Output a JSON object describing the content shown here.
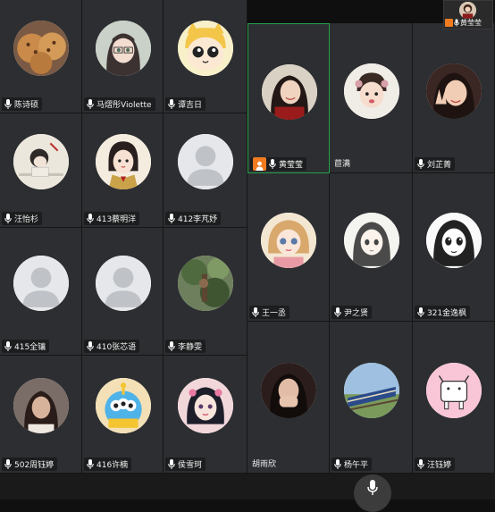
{
  "left_grid": {
    "rows": [
      [
        {
          "name": "陈诗硕",
          "avatar": "cookies",
          "mic": true
        },
        {
          "name": "马熠彤Violette",
          "avatar": "anime-girl",
          "mic": true
        },
        {
          "name": "谭吉日",
          "avatar": "popteam",
          "mic": true
        }
      ],
      [
        {
          "name": "汪怡杉",
          "avatar": "sketch-child",
          "mic": true
        },
        {
          "name": "413蔡明洋",
          "avatar": "cartoon-officer",
          "mic": true
        },
        {
          "name": "412李芃妤",
          "avatar": "default",
          "mic": true
        }
      ],
      [
        {
          "name": "415全镶",
          "avatar": "default",
          "mic": true
        },
        {
          "name": "410张芯语",
          "avatar": "default",
          "mic": true
        },
        {
          "name": "李静雯",
          "avatar": "forest",
          "mic": true
        }
      ],
      [
        {
          "name": "502周钰婷",
          "avatar": "photo-girl",
          "mic": true
        },
        {
          "name": "416许楠",
          "avatar": "toy-alien",
          "mic": true
        },
        {
          "name": "侯雪珂",
          "avatar": "anime-pink",
          "mic": true
        }
      ]
    ]
  },
  "right_grid": {
    "rows": [
      [
        {
          "name": "黄莹莹",
          "avatar": "girl-smile",
          "mic": true,
          "host": true,
          "active": true
        },
        {
          "name": "苣满",
          "avatar": "baby",
          "mic": false
        },
        {
          "name": "刘芷菁",
          "avatar": "girl-peace",
          "mic": true
        }
      ],
      [
        {
          "name": "王一丞",
          "avatar": "doll",
          "mic": true
        },
        {
          "name": "尹之贤",
          "avatar": "manga-girl",
          "mic": true
        },
        {
          "name": "321金逸枫",
          "avatar": "manga-bw",
          "mic": true
        }
      ],
      [
        {
          "name": "胡雨欣",
          "avatar": "girl-hand",
          "mic": false
        },
        {
          "name": "杨午平",
          "avatar": "train",
          "mic": true
        },
        {
          "name": "汪钰婷",
          "avatar": "doodle-cow",
          "mic": true
        }
      ]
    ]
  },
  "self_view": {
    "name": "黄莹莹",
    "host": true
  },
  "colors": {
    "tile_bg": "#2c2e31",
    "active_border": "#27a14a",
    "host_badge": "#f07c1f"
  }
}
